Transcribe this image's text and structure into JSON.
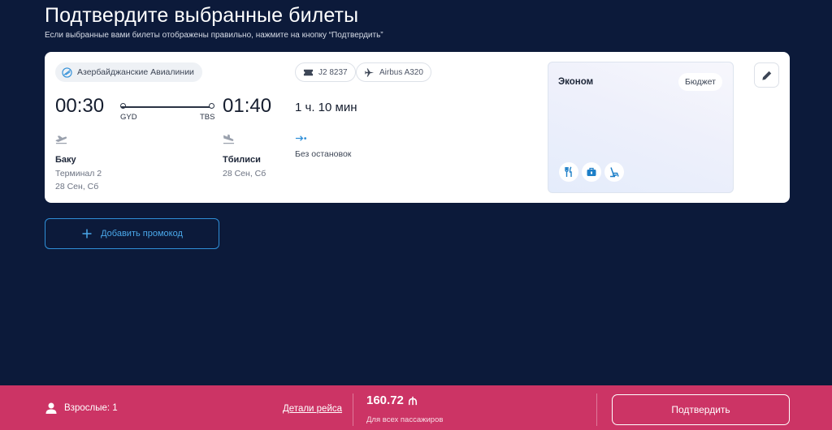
{
  "header": {
    "title": "Подтвердите выбранные билеты",
    "subtitle": "Если выбранные вами билеты отображены правильно, нажмите на кнопку “Подтвердить”"
  },
  "ticket": {
    "airline": "Азербайджанские Авиалинии",
    "flight_number": "J2 8237",
    "aircraft": "Airbus A320",
    "departure": {
      "time": "00:30",
      "code": "GYD",
      "city": "Баку",
      "terminal": "Терминал 2",
      "date": "28 Сен, Сб"
    },
    "arrival": {
      "time": "01:40",
      "code": "TBS",
      "city": "Тбилиси",
      "date": "28 Сен, Сб"
    },
    "duration": "1 ч. 10 мин",
    "stops": "Без остановок",
    "fare": {
      "class": "Эконом",
      "badge": "Бюджет",
      "amenities": [
        "meal-icon",
        "baggage-icon",
        "seat-icon"
      ]
    }
  },
  "promo": {
    "label": "Добавить промокод"
  },
  "footer": {
    "passengers": "Взрослые: 1",
    "details_link": "Детали рейса",
    "price": "160.72",
    "currency_icon": "manat-icon",
    "price_note": "Для всех пассажиров",
    "confirm_label": "Подтвердить"
  },
  "colors": {
    "background": "#0c1a3a",
    "footer": "#cc3465",
    "accent": "#2f8fd8"
  }
}
